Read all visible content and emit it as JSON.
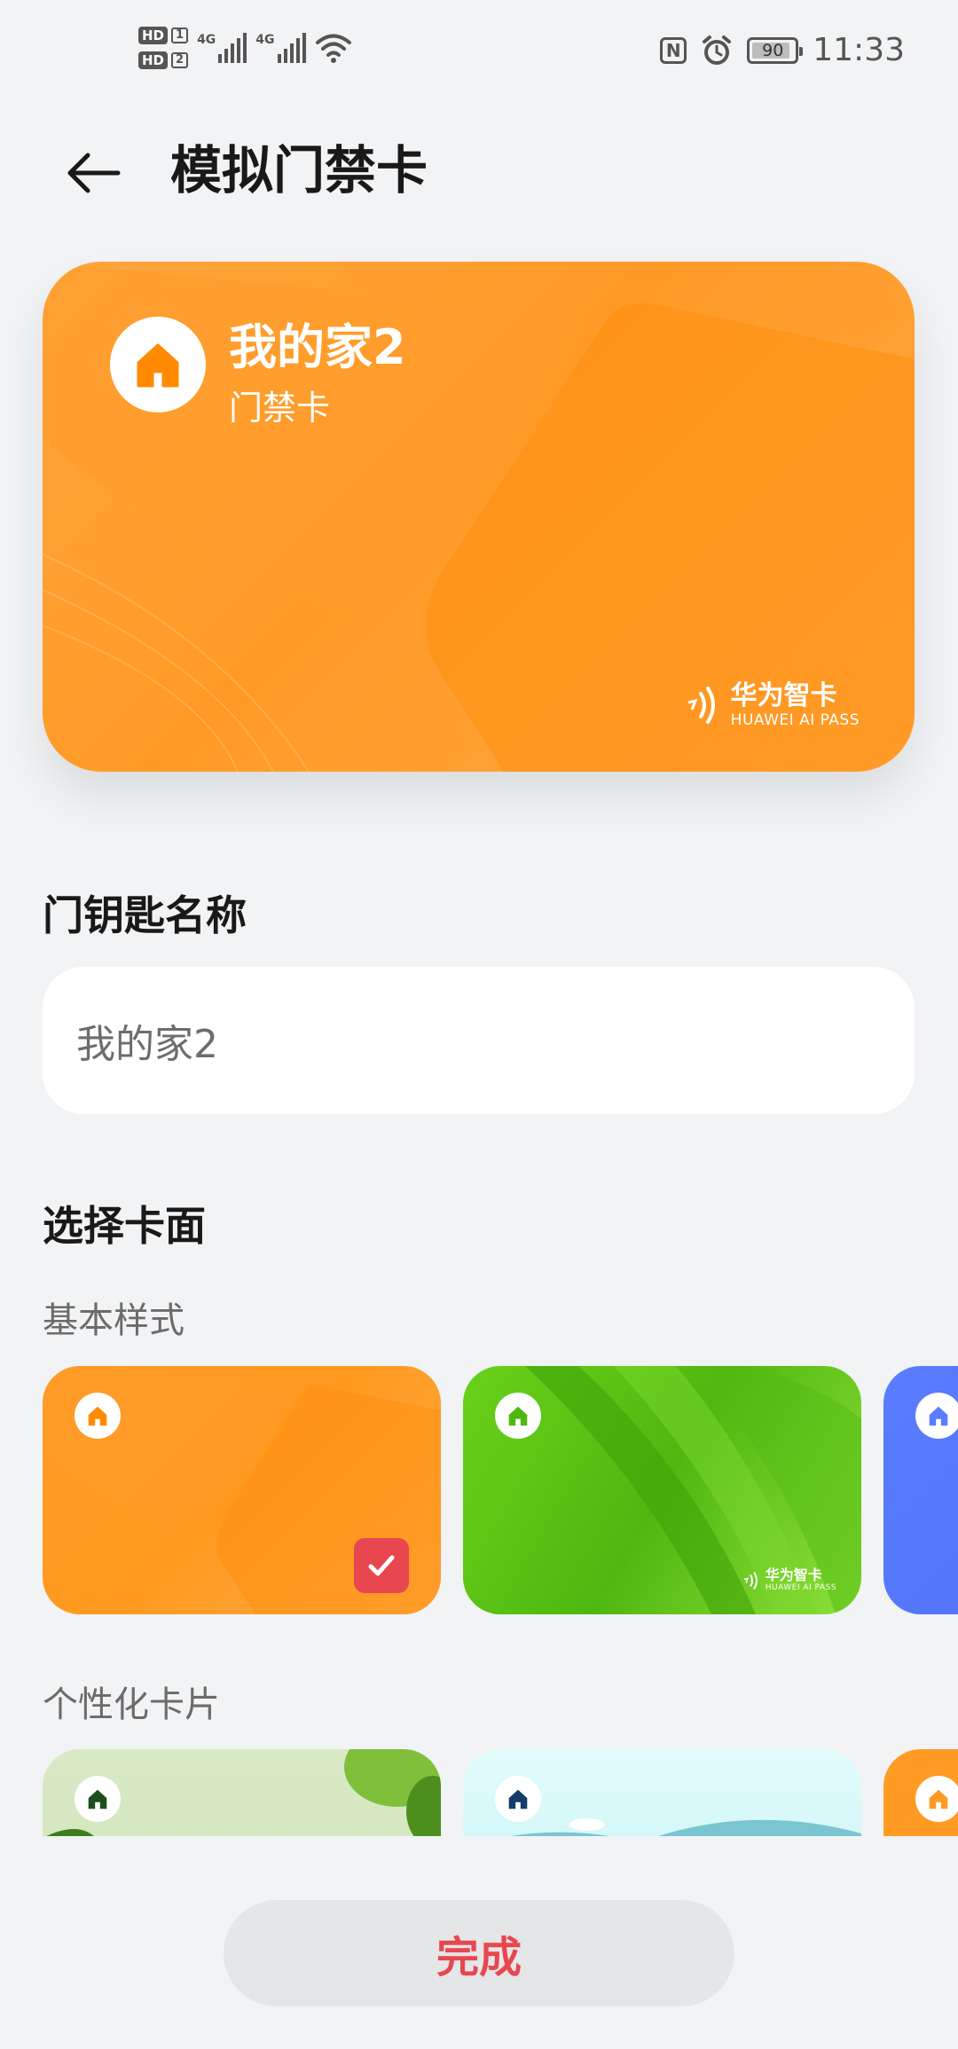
{
  "status_bar": {
    "sim1_badge": "HD",
    "sim1_num": "1",
    "sim2_badge": "HD",
    "sim2_num": "2",
    "network1": "4G",
    "network2": "4G",
    "battery_level": 90,
    "battery_text": "90",
    "time": "11:33",
    "nfc_label": "N"
  },
  "header": {
    "title": "模拟门禁卡"
  },
  "card_preview": {
    "name": "我的家2",
    "type": "门禁卡",
    "brand_cn": "华为智卡",
    "brand_en": "HUAWEI AI PASS"
  },
  "key_name_section": {
    "label": "门钥匙名称",
    "value": "我的家2"
  },
  "card_face_section": {
    "label": "选择卡面",
    "basic_label": "基本样式",
    "personal_label": "个性化卡片",
    "basic_styles": [
      {
        "style": "orange",
        "selected": true
      },
      {
        "style": "green",
        "selected": false
      },
      {
        "style": "blue",
        "selected": false
      }
    ],
    "thumb_brand_cn": "华为智卡",
    "thumb_brand_en": "HUAWEI AI PASS"
  },
  "footer": {
    "done_label": "完成"
  },
  "colors": {
    "accent_red": "#e8474f",
    "card_orange": "#ff9a26",
    "card_green": "#5cc414",
    "card_blue": "#5a7cff"
  }
}
